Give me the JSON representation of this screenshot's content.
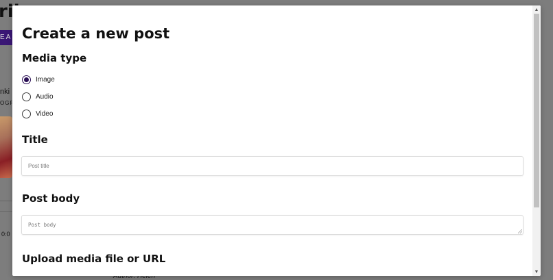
{
  "background": {
    "page_title_fragment": "rib",
    "button_fragment": "EAM",
    "card_title_fragment": "nki",
    "card_subtitle_fragment": "OGRA",
    "time_fragment": "0:0",
    "author_text": "Author: Helen"
  },
  "modal": {
    "title": "Create a new post",
    "media_type": {
      "heading": "Media type",
      "options": [
        {
          "label": "Image",
          "checked": true
        },
        {
          "label": "Audio",
          "checked": false
        },
        {
          "label": "Video",
          "checked": false
        }
      ]
    },
    "title_section": {
      "heading": "Title",
      "placeholder": "Post title"
    },
    "body_section": {
      "heading": "Post body",
      "placeholder": "Post body"
    },
    "upload_section": {
      "heading": "Upload media file or URL"
    }
  },
  "icons": {
    "scroll_up": "triangle-up-icon",
    "scroll_down": "triangle-down-icon"
  },
  "colors": {
    "accent": "#2a0f55",
    "overlay": "#7d7d7d",
    "modal_bg": "#ffffff"
  }
}
